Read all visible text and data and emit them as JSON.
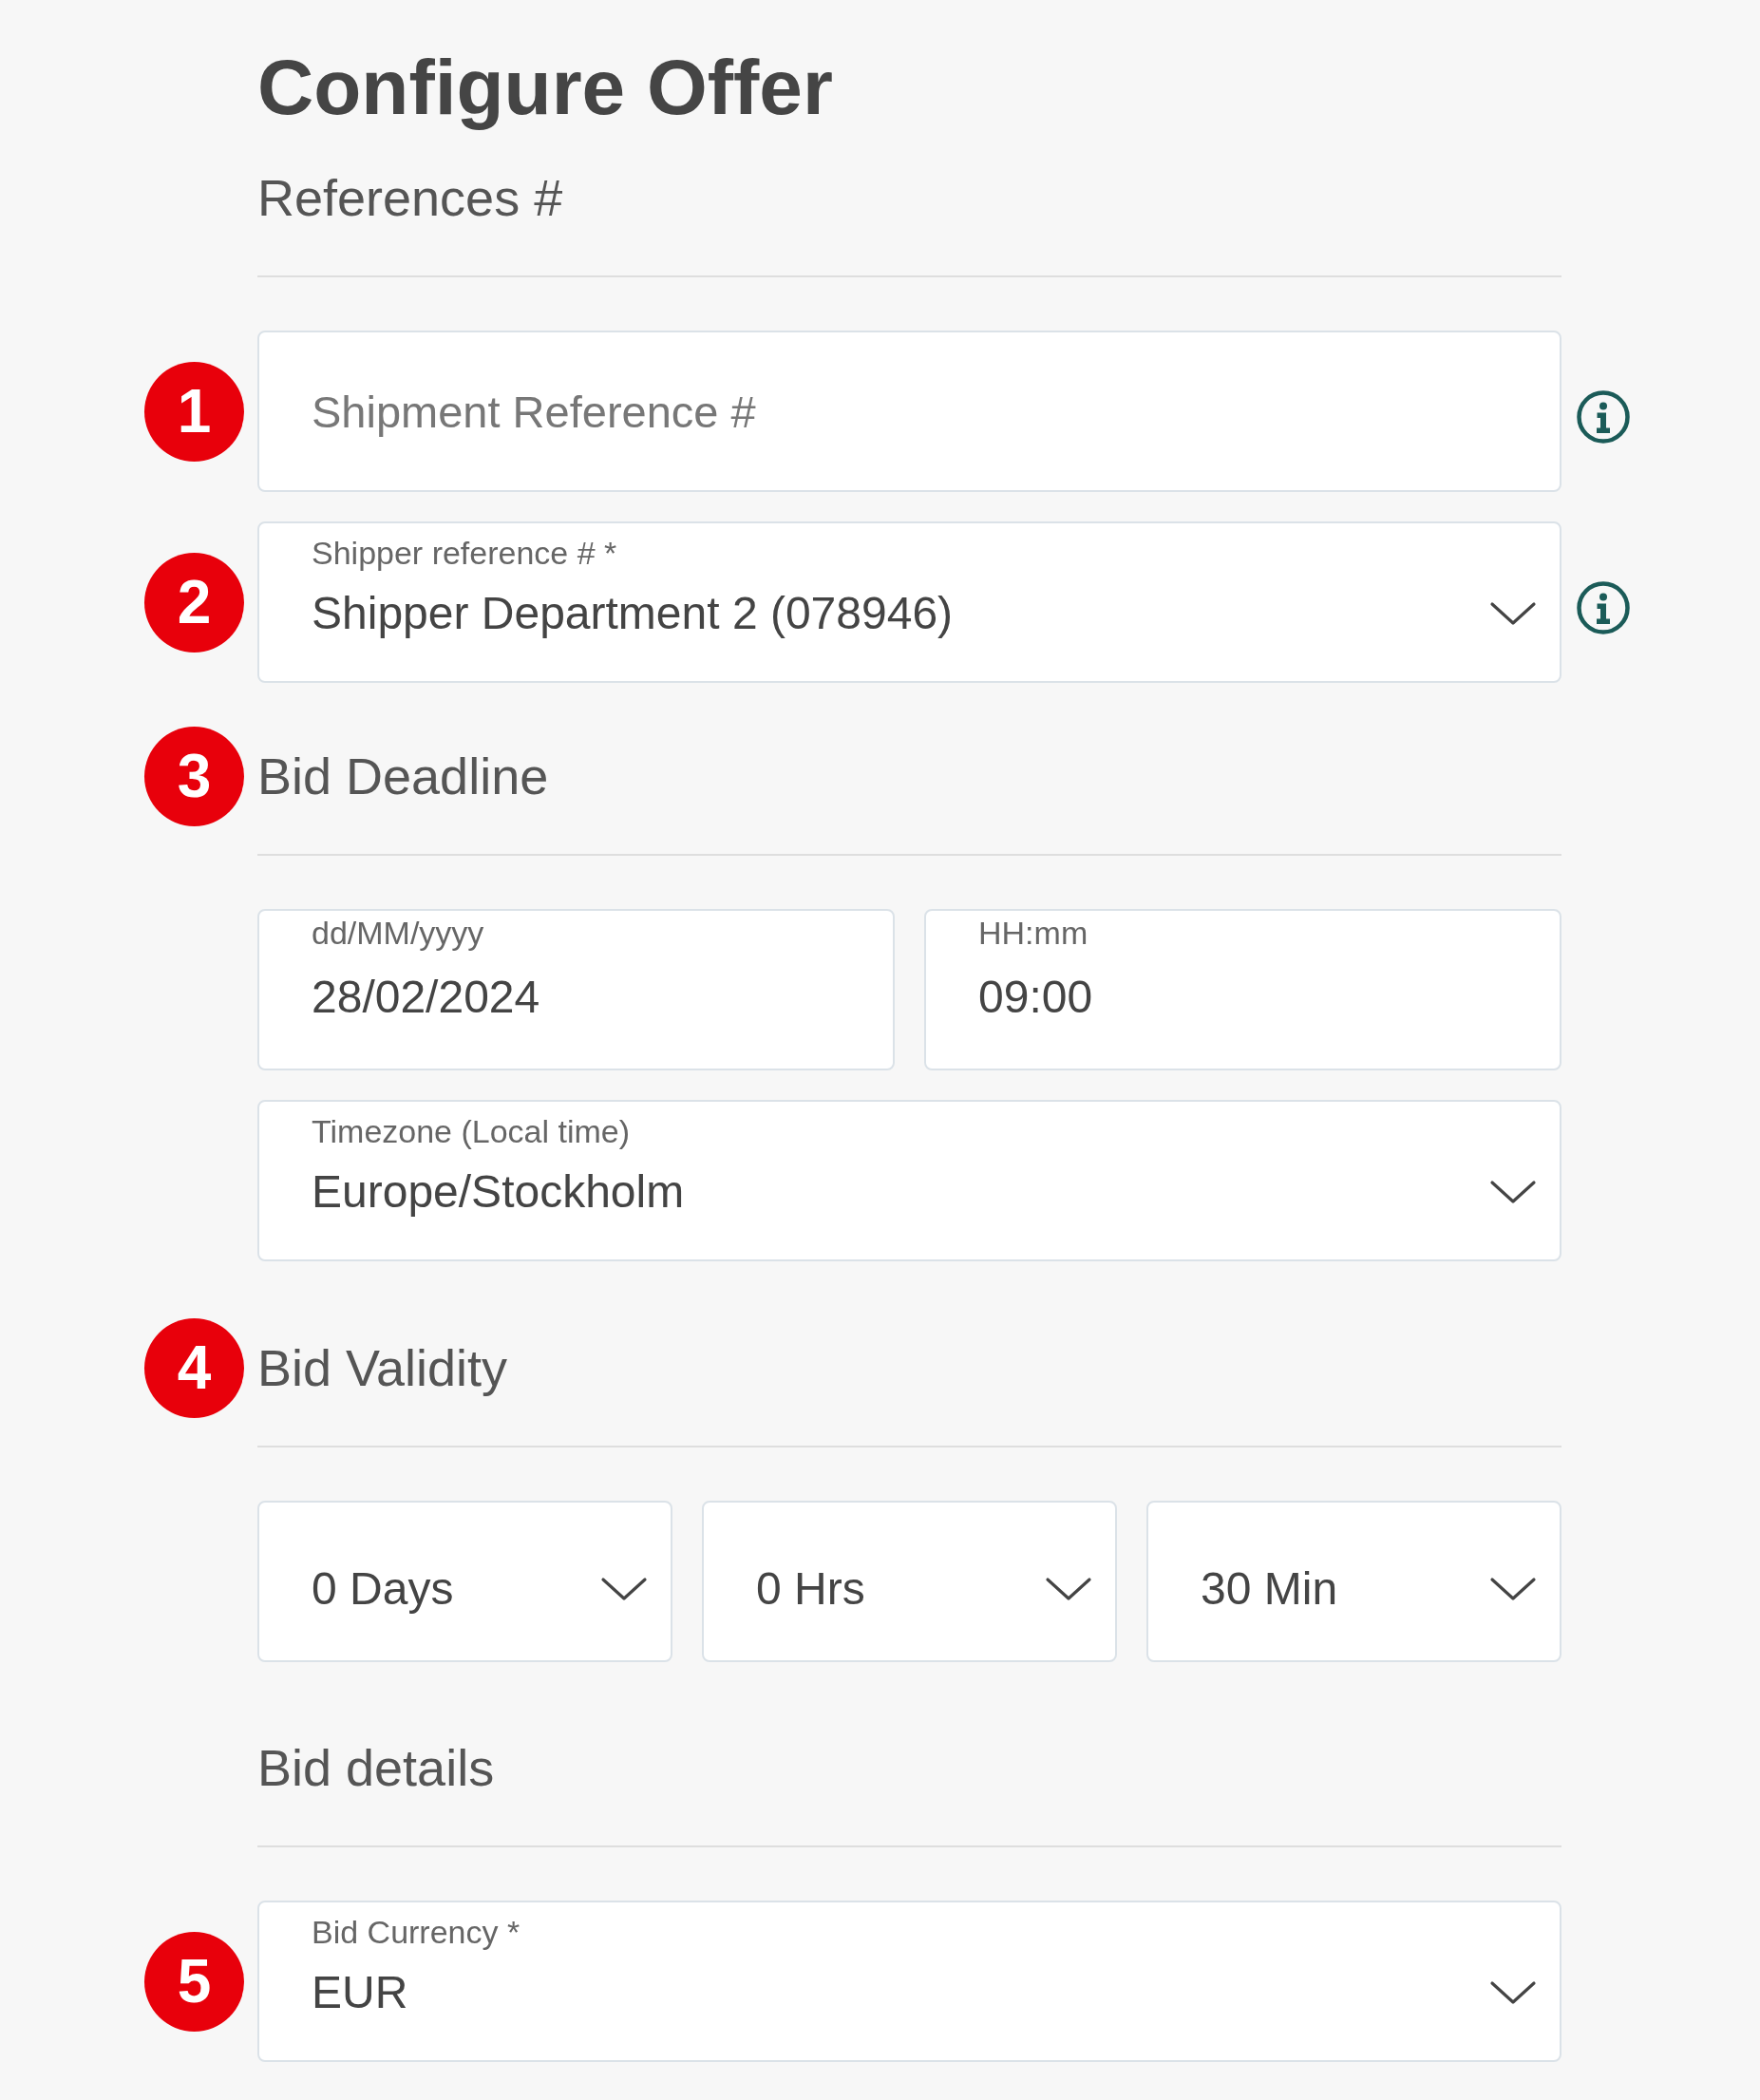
{
  "title": "Configure Offer",
  "sections": [
    {
      "heading": "References #",
      "rows": [
        {
          "marker": "1",
          "info": true,
          "fields": [
            {
              "kind": "text",
              "placeholder": "Shipment Reference #"
            }
          ]
        },
        {
          "marker": "2",
          "info": true,
          "fields": [
            {
              "kind": "select",
              "label": "Shipper reference # *",
              "value": "Shipper Department 2 (078946)"
            }
          ]
        }
      ]
    },
    {
      "heading": "Bid Deadline",
      "marker": "3",
      "rows": [
        {
          "info": false,
          "fields": [
            {
              "kind": "text",
              "label": "dd/MM/yyyy",
              "value": "28/02/2024"
            },
            {
              "kind": "text",
              "label": "HH:mm",
              "value": "09:00"
            }
          ]
        },
        {
          "info": false,
          "fields": [
            {
              "kind": "select",
              "label": "Timezone (Local time)",
              "value": "Europe/Stockholm"
            }
          ]
        }
      ]
    },
    {
      "heading": "Bid Validity",
      "marker": "4",
      "rows": [
        {
          "info": false,
          "fields": [
            {
              "kind": "select",
              "value": "0 Days"
            },
            {
              "kind": "select",
              "value": "0 Hrs"
            },
            {
              "kind": "select",
              "value": "30 Min"
            }
          ]
        }
      ]
    },
    {
      "heading": "Bid details",
      "rows": [
        {
          "marker": "5",
          "info": false,
          "fields": [
            {
              "kind": "select",
              "label": "Bid Currency *",
              "value": "EUR"
            }
          ]
        }
      ]
    }
  ]
}
